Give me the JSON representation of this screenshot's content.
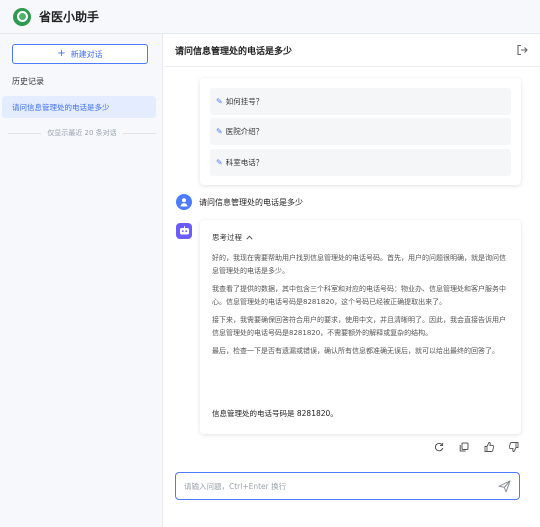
{
  "app": {
    "title": "省医小助手"
  },
  "sidebar": {
    "new_chat_label": "新建对话",
    "history_title": "历史记录",
    "history_items": [
      {
        "label": "请问信息管理处的电话是多少"
      }
    ],
    "history_note": "仅显示最近 20 条对话"
  },
  "chat": {
    "title": "请问信息管理处的电话是多少",
    "suggestions": [
      {
        "label": "如何挂号？"
      },
      {
        "label": "医院介绍？"
      },
      {
        "label": "科室电话？"
      }
    ],
    "user_message": "请问信息管理处的电话是多少",
    "thinking": {
      "title": "思考过程",
      "paragraphs": [
        "好的，我现在需要帮助用户找到信息管理处的电话号码。首先，用户的问题很明确，就是询问信息管理处的电话是多少。",
        "我查看了提供的数据，其中包含三个科室和对应的电话号码：物业办、信息管理处和客户服务中心。信息管理处的电话号码是8281820，这个号码已经被正确提取出来了。",
        "接下来，我需要确保回答符合用户的要求，使用中文，并且清晰明了。因此，我会直接告诉用户信息管理处的电话号码是8281820，不需要额外的解释或复杂的结构。",
        "最后，检查一下是否有遗漏或错误，确认所有信息都准确无误后，就可以给出最终的回答了。"
      ]
    },
    "answer": "信息管理处的电话号码是 8281820。"
  },
  "input": {
    "placeholder": "请输入问题，Ctrl+Enter 换行"
  },
  "colors": {
    "accent": "#4b7bff",
    "logo": "#2e9a4f",
    "bot": "#6a5cff"
  }
}
